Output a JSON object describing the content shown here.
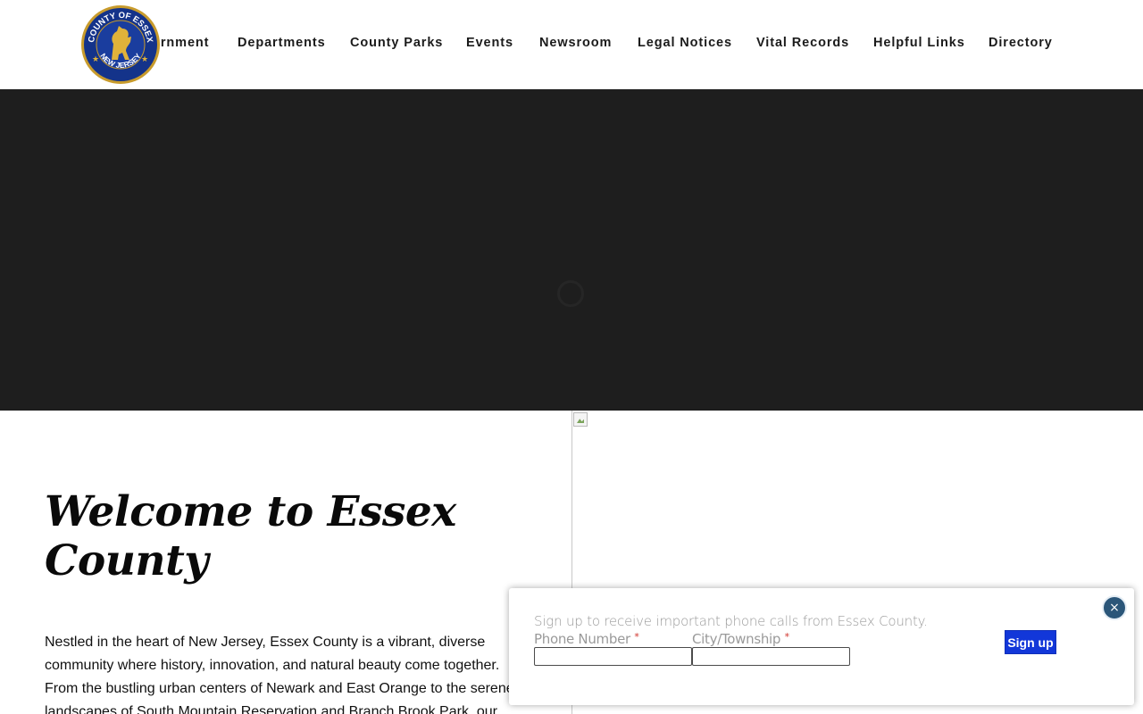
{
  "header": {
    "logo": {
      "top_text": "COUNTY OF ESSEX",
      "bottom_text": "NEW JERSEY",
      "colors": {
        "ring": "#c89b2c",
        "field": "#14338a",
        "lion": "#e0b23a"
      }
    },
    "nav": [
      {
        "label": "Government"
      },
      {
        "label": "Departments"
      },
      {
        "label": "County Parks"
      },
      {
        "label": "Events"
      },
      {
        "label": "Newsroom"
      },
      {
        "label": "Legal Notices"
      },
      {
        "label": "Vital Records"
      },
      {
        "label": "Helpful Links"
      },
      {
        "label": "Directory"
      }
    ]
  },
  "hero": {
    "background": "#1e1e1e",
    "loading_icon": "spinner-icon"
  },
  "welcome": {
    "title": "Welcome to Essex County",
    "body": "Nestled in the heart of New Jersey, Essex County is a vibrant, diverse community where history, innovation, and natural beauty come together. From the bustling urban centers of Newark and East Orange to the serene landscapes of South Mountain Reservation and Branch Brook Park, our"
  },
  "image_panel": {
    "icon": "broken-image-icon"
  },
  "popup": {
    "heading": "Sign up to receive important phone calls from Essex County.",
    "phone_label": "Phone Number",
    "city_label": "City/Township",
    "required_mark": "*",
    "phone_value": "",
    "city_value": "",
    "signup_label": "Sign up",
    "close_label": "×",
    "colors": {
      "button": "#1237d9",
      "close": "#2b5679",
      "required": "#d0342c"
    }
  }
}
